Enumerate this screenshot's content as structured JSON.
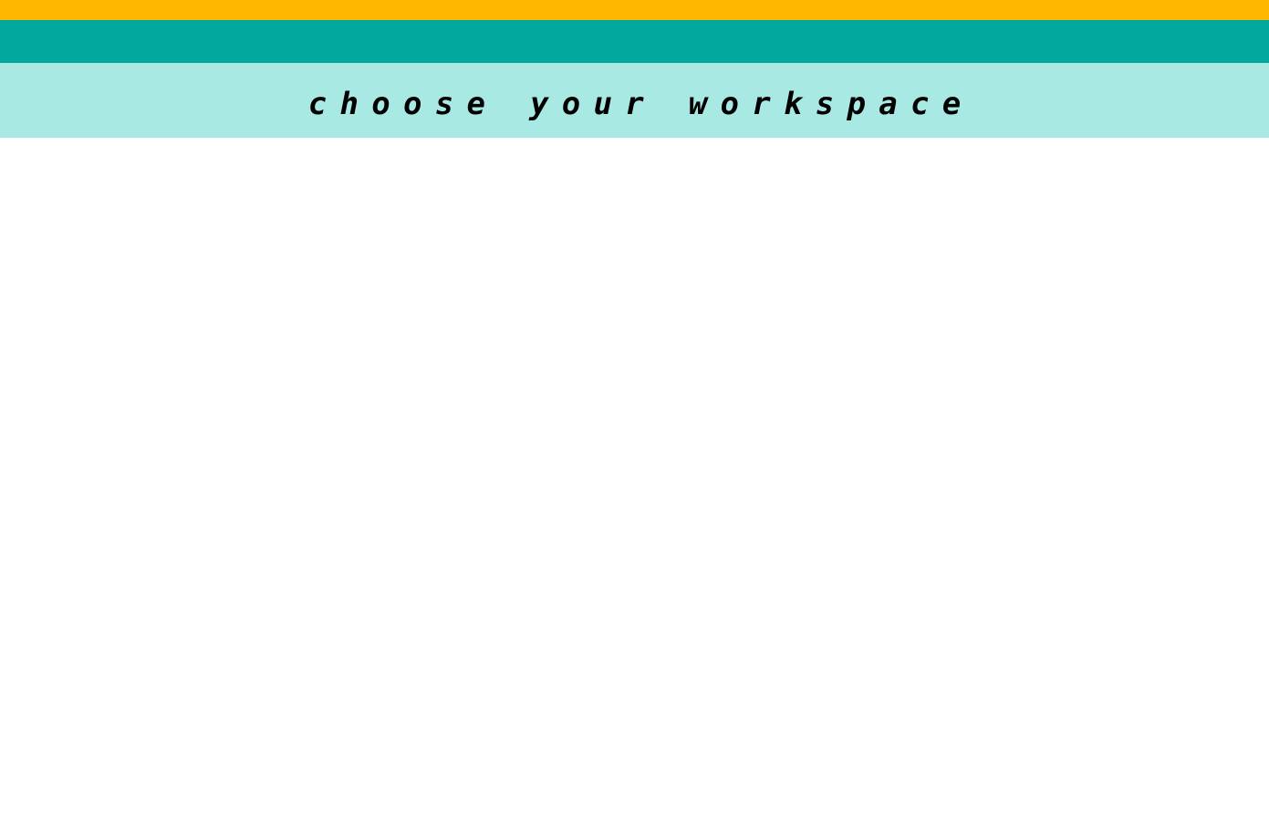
{
  "colors": {
    "accent_top": "#FFB700",
    "app_bar": "#00A89D",
    "banner": "#A8E9E3",
    "background": "#FFFFFF",
    "text": "#000000"
  },
  "header": {
    "title": "choose your workspace"
  }
}
